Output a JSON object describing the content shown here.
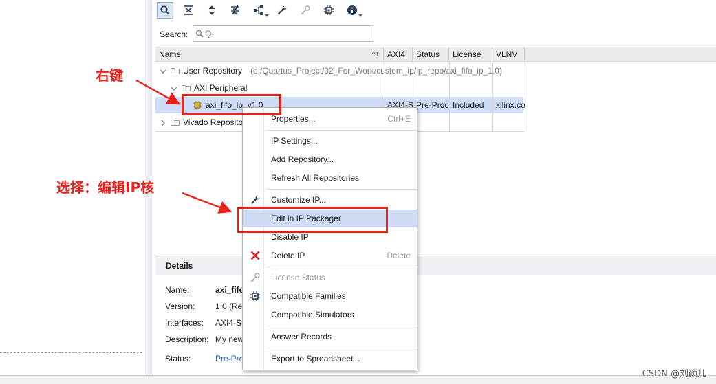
{
  "search": {
    "label": "Search:",
    "placeholder": "Q-"
  },
  "table": {
    "columns": {
      "name": "Name",
      "sort_indicator": "^1",
      "axi4": "AXI4",
      "status": "Status",
      "license": "License",
      "vlnv": "VLNV"
    },
    "rows": [
      {
        "label": "User Repository",
        "detail": "(e:/Quartus_Project/02_For_Work/custom_ip/ip_repo/axi_fifo_ip_1.0)"
      },
      {
        "label": "AXI Peripheral"
      },
      {
        "label": "axi_fifo_ip_v1.0",
        "axi4": "AXI4-S",
        "status": "Pre-Proc",
        "license": "Included",
        "vlnv": "xilinx.co"
      },
      {
        "label": "Vivado Repository"
      }
    ]
  },
  "details": {
    "title": "Details",
    "rows": [
      {
        "label": "Name:",
        "value": "axi_fifo"
      },
      {
        "label": "Version:",
        "value": "1.0 (Re"
      },
      {
        "label": "Interfaces:",
        "value": "AXI4-St"
      },
      {
        "label": "Description:",
        "value": "My new"
      },
      {
        "label": "Status:",
        "value": "Pre-Pro"
      }
    ]
  },
  "context_menu": {
    "items": [
      {
        "label": "Properties...",
        "shortcut": "Ctrl+E",
        "icon": "none"
      },
      {
        "label": "IP Settings...",
        "icon": "none"
      },
      {
        "label": "Add Repository...",
        "icon": "none"
      },
      {
        "label": "Refresh All Repositories",
        "icon": "none"
      },
      {
        "label": "Customize IP...",
        "icon": "wrench-icon"
      },
      {
        "label": "Edit in IP Packager",
        "icon": "none",
        "state": "hovered"
      },
      {
        "label": "Disable IP",
        "icon": "none"
      },
      {
        "label": "Delete IP",
        "shortcut": "Delete",
        "icon": "red-x-icon"
      },
      {
        "label": "License Status",
        "icon": "key-icon",
        "state": "disabled"
      },
      {
        "label": "Compatible Families",
        "icon": "chip-icon"
      },
      {
        "label": "Compatible Simulators",
        "icon": "none"
      },
      {
        "label": "Answer Records",
        "icon": "none"
      },
      {
        "label": "Export to Spreadsheet...",
        "icon": "none"
      }
    ]
  },
  "annotations": {
    "right_click": "右键",
    "select_edit": "选择：编辑IP核"
  },
  "watermark": "CSDN @刘颜儿",
  "colors": {
    "annotation_red": "#e8221b",
    "selection_blue": "#cfdcf5",
    "link_blue": "#2a5fb0"
  }
}
